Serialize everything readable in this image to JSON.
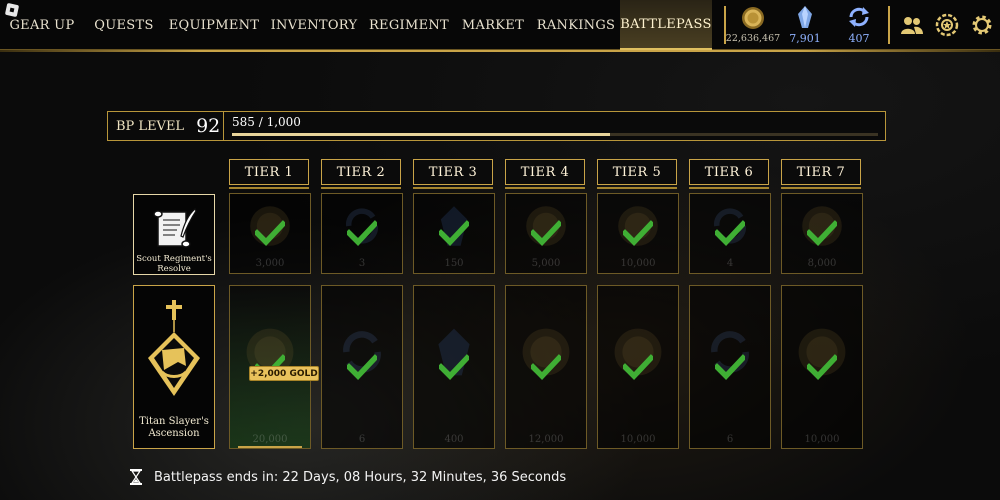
{
  "nav": {
    "items": [
      {
        "label": "GEAR UP"
      },
      {
        "label": "QUESTS"
      },
      {
        "label": "EQUIPMENT"
      },
      {
        "label": "INVENTORY"
      },
      {
        "label": "REGIMENT"
      },
      {
        "label": "MARKET"
      },
      {
        "label": "RANKINGS"
      },
      {
        "label": "BATTLEPASS",
        "active": true
      }
    ]
  },
  "currencies": {
    "gold": {
      "value": "22,636,467",
      "icon": "gold-coin-icon",
      "color": "#c8c2b0"
    },
    "crystals": {
      "value": "7,901",
      "icon": "crystal-icon",
      "color": "#8fb2ff"
    },
    "spins": {
      "value": "407",
      "icon": "spin-icon",
      "color": "#8fb2ff"
    }
  },
  "top_icons": [
    "friends-icon",
    "regiment-badge-icon",
    "settings-icon"
  ],
  "battlepass": {
    "level_label": "BP LEVEL",
    "level": "92",
    "progress_text": "585 / 1,000",
    "progress": 0.585
  },
  "tiers": [
    "TIER 1",
    "TIER 2",
    "TIER 3",
    "TIER 4",
    "TIER 5",
    "TIER 6",
    "TIER 7"
  ],
  "rows": {
    "free": {
      "label": "Scout Regiment's Resolve",
      "icon": "scroll-quill-icon",
      "rewards": [
        {
          "kind": "gold",
          "amount": "3,000"
        },
        {
          "kind": "spin",
          "amount": "3"
        },
        {
          "kind": "shard",
          "amount": "150"
        },
        {
          "kind": "gold",
          "amount": "5,000"
        },
        {
          "kind": "gold",
          "amount": "10,000"
        },
        {
          "kind": "spin",
          "amount": "4"
        },
        {
          "kind": "gold",
          "amount": "8,000"
        }
      ]
    },
    "premium": {
      "label": "Titan Slayer's Ascension",
      "icon": "premium-crest-icon",
      "rewards": [
        {
          "kind": "gold",
          "amount": "20,000"
        },
        {
          "kind": "spin",
          "amount": "6"
        },
        {
          "kind": "shard",
          "amount": "400"
        },
        {
          "kind": "gold",
          "amount": "12,000"
        },
        {
          "kind": "gold",
          "amount": "10,000"
        },
        {
          "kind": "spin",
          "amount": "6"
        },
        {
          "kind": "gold",
          "amount": "10,000"
        }
      ]
    }
  },
  "popup": {
    "text": "+2,000 GOLD"
  },
  "footer": {
    "icon": "hourglass-icon",
    "text": "Battlepass ends in: 22 Days, 08 Hours, 32 Minutes, 36 Seconds"
  }
}
